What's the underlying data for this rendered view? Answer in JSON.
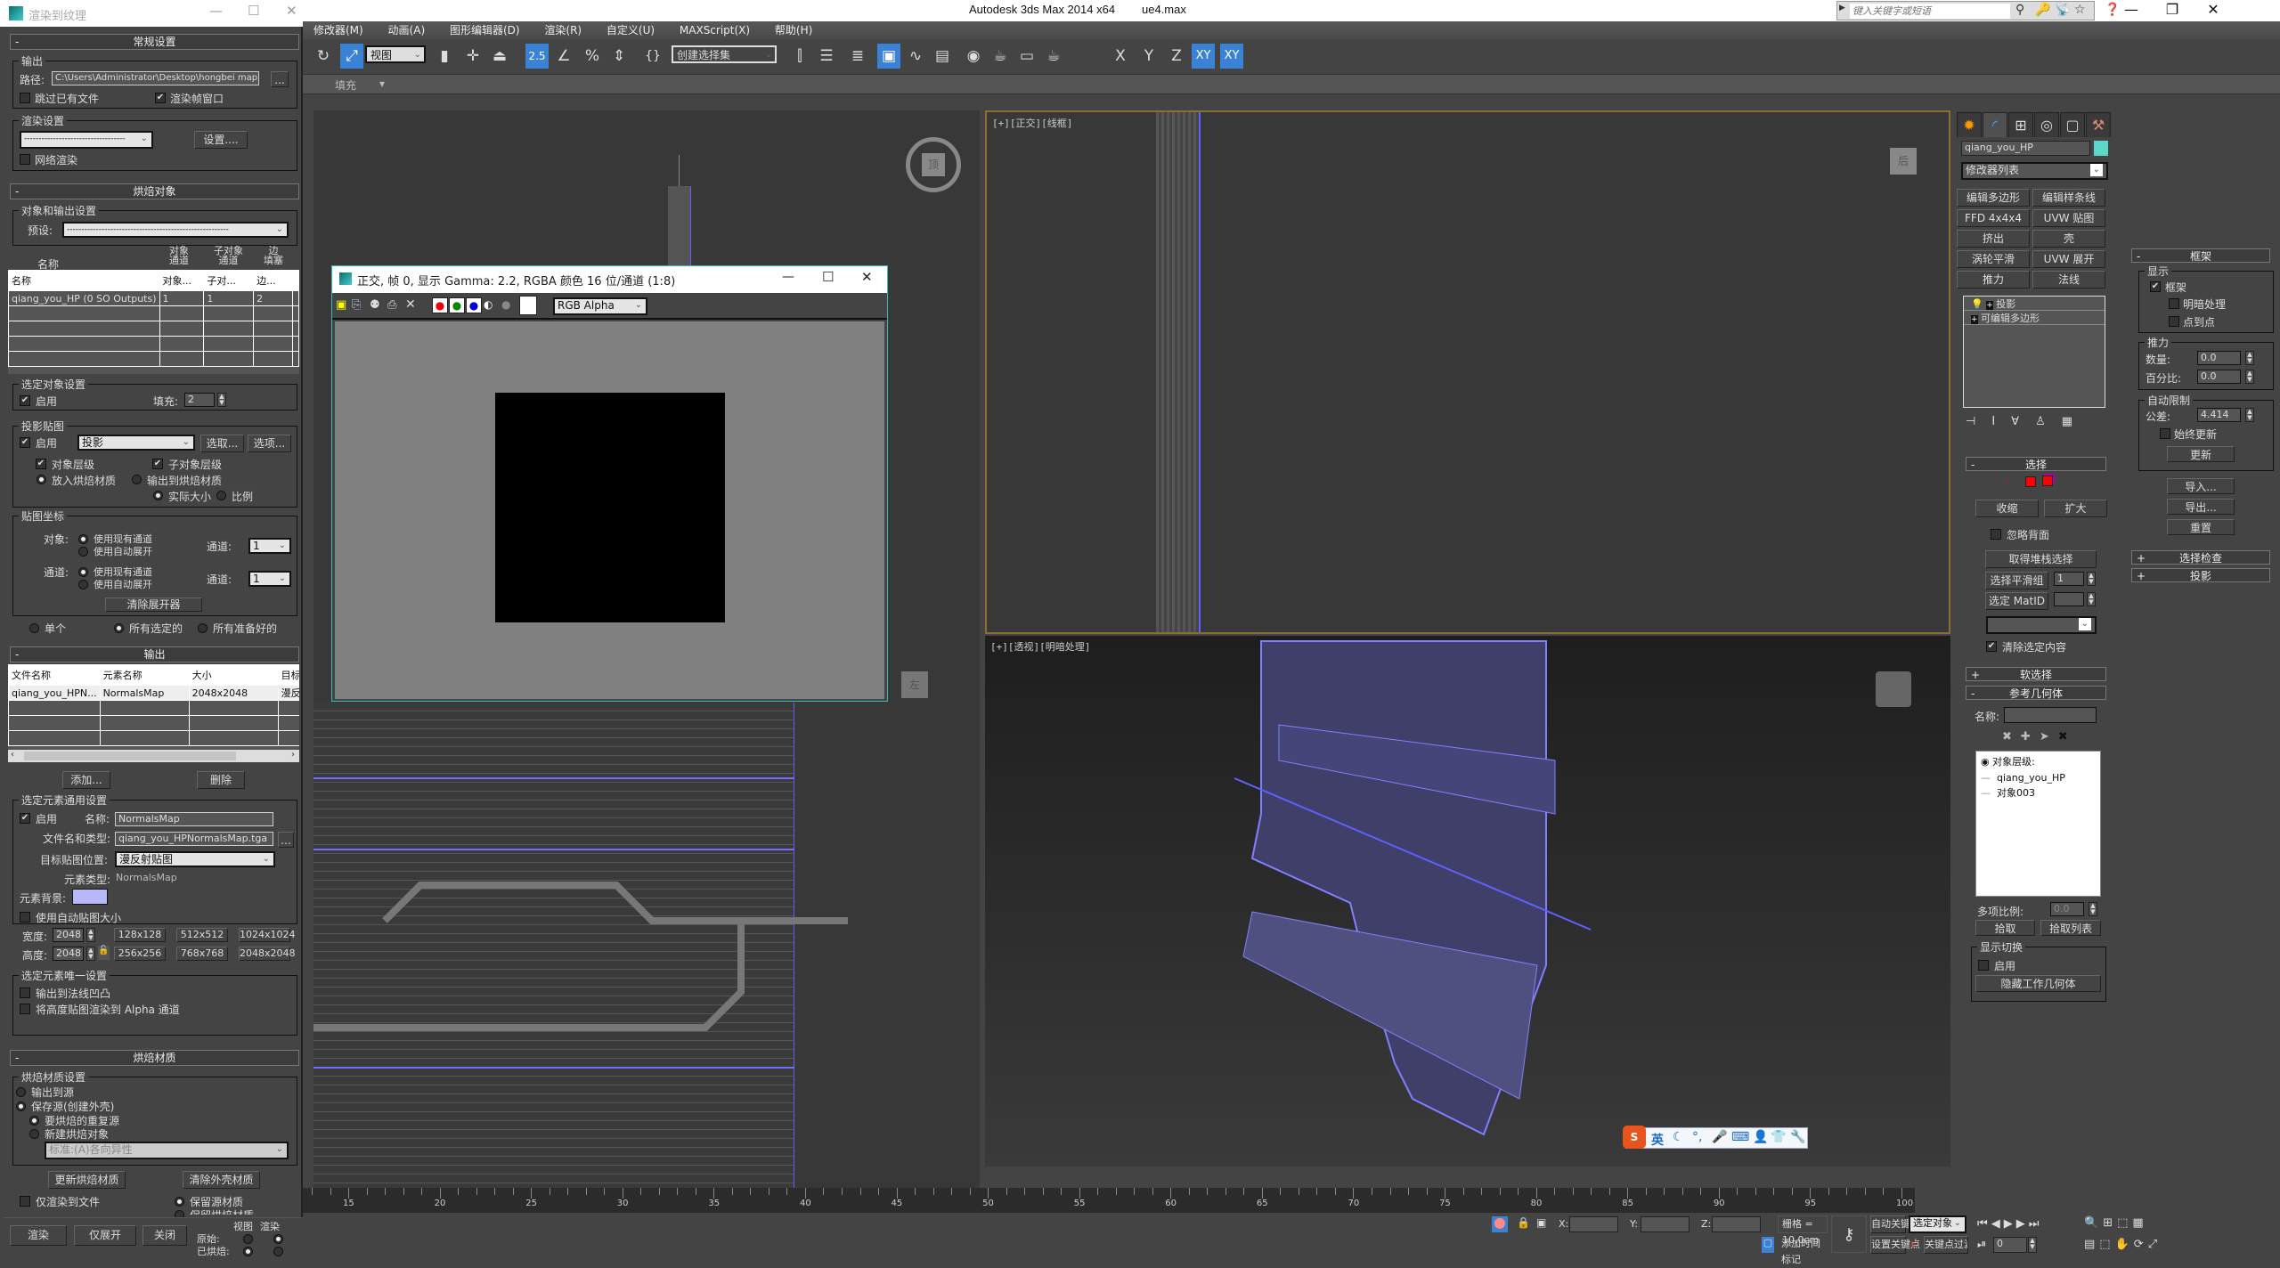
{
  "app": {
    "title": "Autodesk 3ds Max  2014 x64",
    "file": "ue4.max",
    "search_placeholder": "键入关键字或短语"
  },
  "menu": [
    "修改器(M)",
    "动画(A)",
    "图形编辑器(D)",
    "渲染(R)",
    "自定义(U)",
    "MAXScript(X)",
    "帮助(H)"
  ],
  "toolbar": {
    "view_dropdown": "视图",
    "snap_value": "2.5",
    "selection_set": "创建选择集",
    "axis": [
      "X",
      "Y",
      "Z",
      "XY",
      "XY"
    ]
  },
  "ribbon": {
    "label": "填充"
  },
  "rtt": {
    "title": "渲染到纹理",
    "general": {
      "rollout": "常规设置",
      "output_group": "输出",
      "path_label": "路径:",
      "path_value": "C:\\Users\\Administrator\\Desktop\\hongbei map",
      "browse": "...",
      "skip_existing": "跳过已有文件",
      "skip_existing_checked": false,
      "render_frame_window": "渲染帧窗口",
      "render_frame_window_checked": true,
      "render_settings_group": "渲染设置",
      "render_preset": "-----------------------------------",
      "setup_button": "设置....",
      "net_render": "网络渲染",
      "net_render_checked": false
    },
    "objects": {
      "rollout": "烘焙对象",
      "group": "对象和输出设置",
      "preset_label": "预设:",
      "preset_value": "--------------------------------------------------------",
      "col_headers_top": [
        "名称",
        "对象\n通道",
        "子对象\n通道",
        "边\n填塞"
      ],
      "table_header": [
        "名称",
        "对象...",
        "子对...",
        "边..."
      ],
      "rows": [
        [
          "qiang_you_HP (0 SO Outputs)",
          "1",
          "1",
          "2"
        ]
      ],
      "selected_settings": "选定对象设置",
      "enable": "启用",
      "enable_checked": true,
      "padding_label": "填充:",
      "padding_value": "2",
      "projection_group": "投影贴图",
      "proj_enable": "启用",
      "proj_enable_checked": true,
      "proj_type": "投影",
      "pick_button": "选取...",
      "options_button": "选项...",
      "object_level": "对象层级",
      "subobject_level": "子对象层级",
      "put_to_bake": "放入烘焙材质",
      "output_to_bake": "输出到烘焙材质",
      "real_size": "实际大小",
      "ratio": "比例",
      "mapping_group": "贴图坐标",
      "object_label": "对象:",
      "channel_label": "通道:",
      "use_existing": "使用现有通道",
      "use_auto": "使用自动展开",
      "channel_dd_label": "通道:",
      "channel_value": "1",
      "clear_unwrap": "清除展开器",
      "single": "单个",
      "all_selected": "所有选定的",
      "all_prepared": "所有准备好的"
    },
    "output": {
      "rollout": "输出",
      "headers": [
        "文件名称",
        "元素名称",
        "大小",
        "目标"
      ],
      "rows": [
        [
          "qiang_you_HPN...",
          "NormalsMap",
          "2048x2048",
          "漫反"
        ]
      ],
      "add": "添加...",
      "delete": "删除",
      "common_group": "选定元素通用设置",
      "enable": "启用",
      "name_label": "名称:",
      "name_value": "NormalsMap",
      "file_label": "文件名和类型:",
      "file_value": "qiang_you_HPNormalsMap.tga",
      "target_label": "目标贴图位置:",
      "target_value": "漫反射贴图",
      "type_label": "元素类型:",
      "type_value": "NormalsMap",
      "bg_label": "元素背景:",
      "bg_color": "#b8b8f8",
      "auto_size": "使用自动贴图大小",
      "width_label": "宽度:",
      "width_value": "2048",
      "height_label": "高度:",
      "height_value": "2048",
      "presets": [
        "128x128",
        "512x512",
        "1024x1024",
        "256x256",
        "768x768",
        "2048x2048"
      ],
      "unique_group": "选定元素唯一设置",
      "output_bump": "输出到法线凹凸",
      "height_alpha": "将高度贴图渲染到 Alpha 通道"
    },
    "baked": {
      "rollout": "烘焙材质",
      "group": "烘焙材质设置",
      "output_to_source": "输出到源",
      "save_source": "保存源(创建外壳)",
      "dup_source": "要烘焙的重复源",
      "new_baked": "新建烘焙对象",
      "material_type": "标准:(A)各向异性",
      "update": "更新烘焙材质",
      "clear_shell": "清除外壳材质",
      "render_to_files": "仅渲染到文件",
      "keep_source": "保留源材质",
      "keep_baked": "保留烘焙材质"
    },
    "footer": {
      "render": "渲染",
      "unwrap_only": "仅展开",
      "close": "关闭",
      "view": "视图",
      "render_col": "渲染",
      "original": "原始:",
      "baked": "已烘焙:"
    }
  },
  "framebuffer": {
    "title": "正交, 帧 0, 显示 Gamma: 2.2, RGBA 颜色 16 位/通道 (1:8)",
    "channel": "RGB Alpha"
  },
  "viewports": {
    "top_left": {
      "gizmo": "顶"
    },
    "top_right": {
      "label": "[+][正交][线框]",
      "gizmo": "后"
    },
    "bottom_left": {
      "gizmo": "左"
    },
    "bottom_right": {
      "label": "[+][透视][明暗处理]"
    }
  },
  "command_panel": {
    "object_name": "qiang_you_HP",
    "object_color": "#5ad8c8",
    "modifier_list": "修改器列表",
    "mod_buttons": [
      "编辑多边形",
      "编辑样条线",
      "FFD 4x4x4",
      "UVW 贴图",
      "挤出",
      "壳",
      "涡轮平滑",
      "UVW 展开",
      "推力",
      "法线"
    ],
    "stack": [
      "投影",
      "可编辑多边形"
    ],
    "select_rollout": "选择",
    "shrink": "收缩",
    "grow": "扩大",
    "ignore_back": "忽略背面",
    "get_stack": "取得堆栈选择",
    "smooth_group": "选择平滑组",
    "smooth_value": "1",
    "mat_id": "选定 MatID",
    "clear_sel": "清除选定内容",
    "soft_sel": "软选择",
    "ref_geo": "参考几何体",
    "name_label": "名称:",
    "ref_list_title": "对象层级:",
    "ref_list": [
      "qiang_you_HP",
      "对象003"
    ],
    "multi_scale_label": "多项比例:",
    "multi_scale_value": "0.0",
    "pick": "拾取",
    "pick_list": "拾取列表",
    "display_toggle": "显示切换",
    "toggle_enable": "启用",
    "hide_working": "隐藏工作几何体",
    "cage": {
      "rollout": "框架",
      "display": "显示",
      "cage": "框架",
      "shaded": "明暗处理",
      "point_to_point": "点到点",
      "push": "推力",
      "amount_label": "数量:",
      "amount_value": "0.0",
      "percent_label": "百分比:",
      "percent_value": "0.0",
      "auto_limit": "自动限制",
      "tolerance_label": "公差:",
      "tolerance_value": "4.414",
      "always_update": "始终更新",
      "update": "更新",
      "import": "导入...",
      "export": "导出...",
      "reset": "重置",
      "sel_check": "选择检查",
      "projection": "投影"
    }
  },
  "timeline": {
    "ticks": [
      "15",
      "20",
      "25",
      "30",
      "35",
      "40",
      "45",
      "50",
      "55",
      "60",
      "65",
      "70",
      "75",
      "80",
      "85",
      "90",
      "95",
      "100"
    ]
  },
  "status": {
    "x_label": "X:",
    "y_label": "Y:",
    "z_label": "Z:",
    "grid": "栅格 = 10.0cm",
    "add_time_tag": "添加时间标记",
    "auto_key": "自动关键点",
    "set_key": "设置关键点",
    "key_mode": "选定对象",
    "key_filters": "关键点过滤器...",
    "frame": "0"
  },
  "ime": {
    "lang": "英"
  }
}
